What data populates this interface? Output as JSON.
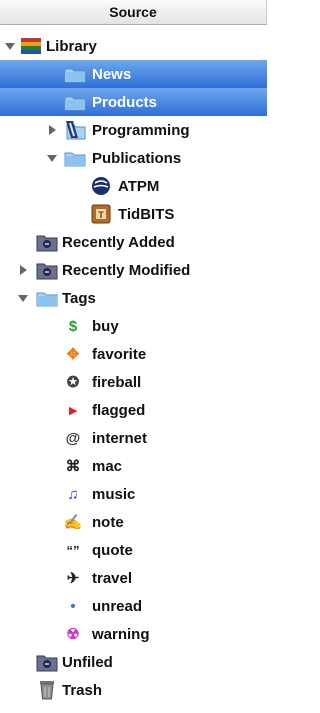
{
  "header": {
    "title": "Source"
  },
  "colors": {
    "selection": "#3b7be0",
    "folder": "#7db6e8",
    "buy": "#2a9a2a",
    "favorite": "#f07b14",
    "flagged": "#e02020",
    "music": "#5a2bd6",
    "unread": "#2a7be4",
    "warning": "#d03ac8"
  },
  "rows": [
    {
      "label": "Library",
      "icon": "library-icon",
      "expanded": true,
      "selected": false
    },
    {
      "label": "News",
      "icon": "folder-icon",
      "selected": true
    },
    {
      "label": "Products",
      "icon": "folder-icon",
      "selected": true
    },
    {
      "label": "Programming",
      "icon": "programming-folder-icon",
      "expanded": false
    },
    {
      "label": "Publications",
      "icon": "folder-icon",
      "expanded": true
    },
    {
      "label": "ATPM",
      "icon": "atpm-icon"
    },
    {
      "label": "TidBITS",
      "icon": "tidbits-icon"
    },
    {
      "label": "Recently Added",
      "icon": "smart-folder-icon"
    },
    {
      "label": "Recently Modified",
      "icon": "smart-folder-icon",
      "expanded": false
    },
    {
      "label": "Tags",
      "icon": "folder-icon",
      "expanded": true
    },
    {
      "label": "buy",
      "icon": "dollar-icon",
      "glyph": "$"
    },
    {
      "label": "favorite",
      "icon": "favorite-icon",
      "glyph": "✥"
    },
    {
      "label": "fireball",
      "icon": "fireball-icon",
      "glyph": "✪"
    },
    {
      "label": "flagged",
      "icon": "flag-icon",
      "glyph": "▸"
    },
    {
      "label": "internet",
      "icon": "at-icon",
      "glyph": "@"
    },
    {
      "label": "mac",
      "icon": "command-icon",
      "glyph": "⌘"
    },
    {
      "label": "music",
      "icon": "music-note-icon",
      "glyph": "♫"
    },
    {
      "label": "note",
      "icon": "note-icon",
      "glyph": "✍"
    },
    {
      "label": "quote",
      "icon": "quote-icon",
      "glyph": "“”"
    },
    {
      "label": "travel",
      "icon": "airplane-icon",
      "glyph": "✈"
    },
    {
      "label": "unread",
      "icon": "dot-icon",
      "glyph": "•"
    },
    {
      "label": "warning",
      "icon": "warning-icon",
      "glyph": "☢"
    },
    {
      "label": "Unfiled",
      "icon": "smart-folder-icon"
    },
    {
      "label": "Trash",
      "icon": "trash-icon"
    }
  ]
}
